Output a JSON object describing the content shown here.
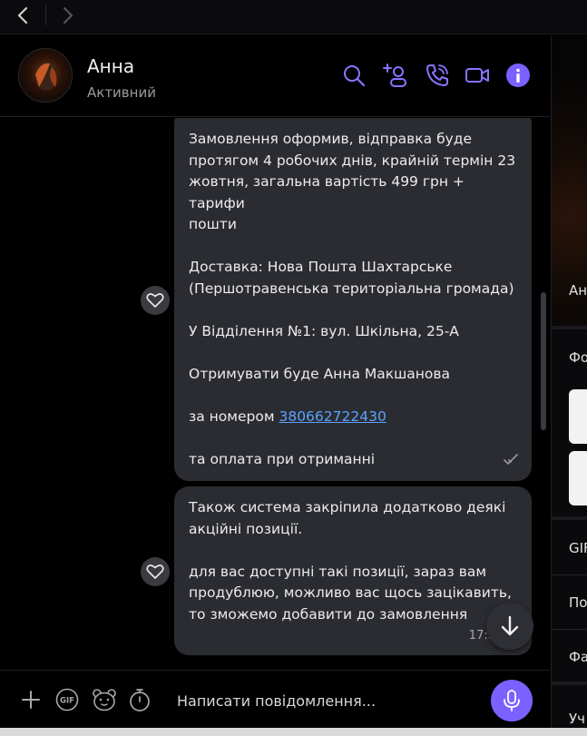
{
  "colors": {
    "accent": "#7b61ff",
    "bubble": "#2b2c31",
    "link": "#5aa3ff",
    "background": "#000000"
  },
  "nav": {
    "back_icon": "chevron-left-icon",
    "forward_icon": "chevron-right-icon"
  },
  "header": {
    "name": "Анна",
    "status": "Активний",
    "icons": [
      "search-icon",
      "add-participant-icon",
      "call-icon",
      "video-call-icon",
      "info-icon"
    ]
  },
  "messages": [
    {
      "lines": [
        "Замовлення оформив, відправка буде",
        "протягом 4 робочих днів, крайній термін 23",
        "жовтня, загальна вартість 499 грн + тарифи",
        "пошти",
        "",
        "Доставка: Нова Пошта  Шахтарське",
        "(Першотравенська територіальна громада)",
        "",
        "У Відділення №1: вул. Шкільна, 25-А",
        "",
        "Отримувати буде Анна Макшанова",
        ""
      ],
      "phone_prefix": "за номером ",
      "phone": "380662722430",
      "last_line": "та оплата при отриманні",
      "status_icon": "read-check-icon"
    },
    {
      "lines": [
        "Також система закріпила додатково деякі",
        "акційні позиції.",
        "",
        "для вас доступні такі позиції, зараз вам",
        "продублюю, можливо вас щось зацікавить,",
        "то зможемо добавити до замовлення"
      ],
      "time": "17:3"
    }
  ],
  "right_panel": {
    "contact_label": "Ан",
    "photos_label": "Фо",
    "gif_label": "GIF",
    "item3_label": "По",
    "item4_label": "Фа",
    "item5_label": "Уч"
  },
  "composer": {
    "placeholder": "Написати повідомлення...",
    "gif_label": "GIF",
    "icons": [
      "plus-icon",
      "gif-icon",
      "sticker-icon",
      "timer-icon",
      "microphone-icon"
    ]
  }
}
